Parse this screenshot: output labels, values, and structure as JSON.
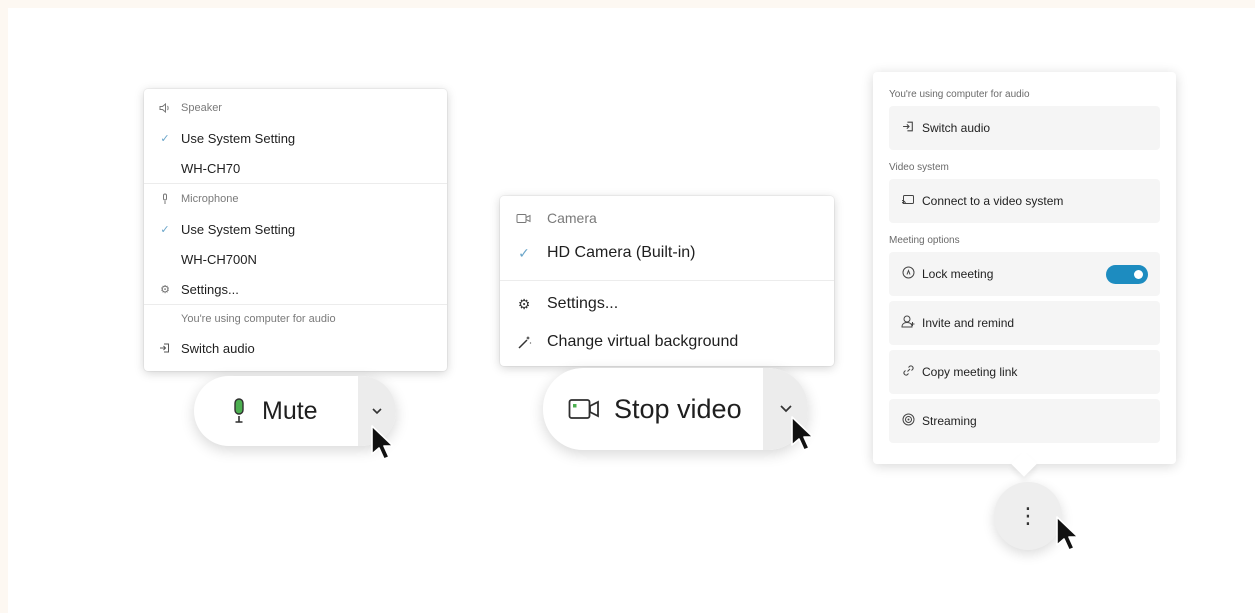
{
  "audio_menu": {
    "speaker_header": "Speaker",
    "speaker_options": [
      {
        "label": "Use System Setting",
        "selected": true
      },
      {
        "label": "WH-CH70",
        "selected": false
      }
    ],
    "microphone_header": "Microphone",
    "microphone_options": [
      {
        "label": "Use System Setting",
        "selected": true
      },
      {
        "label": "WH-CH700N",
        "selected": false
      }
    ],
    "settings_label": "Settings...",
    "audio_note": "You're using computer for audio",
    "switch_audio_label": "Switch audio"
  },
  "mute_button": {
    "label": "Mute"
  },
  "video_menu": {
    "camera_header": "Camera",
    "camera_option": "HD Camera (Built-in)",
    "settings_label": "Settings...",
    "virtual_bg_label": "Change virtual background"
  },
  "video_button": {
    "label": "Stop video"
  },
  "options_panel": {
    "audio_section_label": "You're using computer for audio",
    "switch_audio_label": "Switch audio",
    "video_section_label": "Video system",
    "connect_video_label": "Connect to a video system",
    "meeting_section_label": "Meeting options",
    "lock_meeting_label": "Lock meeting",
    "lock_meeting_on": true,
    "invite_label": "Invite and remind",
    "copy_link_label": "Copy meeting link",
    "streaming_label": "Streaming"
  },
  "more_button": {
    "glyph": "⋮"
  },
  "colors": {
    "mic_icon": "#4caf50",
    "toggle_on": "#1d8cc0",
    "check": "#6aa5c9"
  }
}
